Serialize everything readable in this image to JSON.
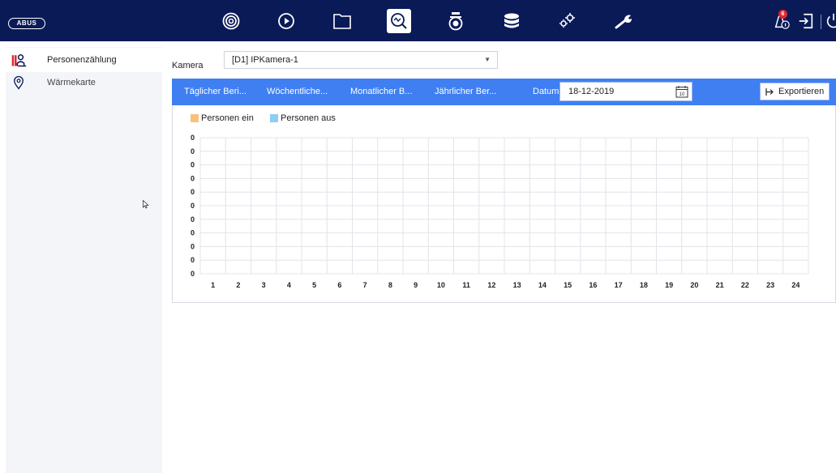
{
  "topbar": {
    "logo_text": "ABUS",
    "nav_icons": [
      {
        "name": "live-view-icon",
        "active": false
      },
      {
        "name": "playback-icon",
        "active": false
      },
      {
        "name": "file-manager-icon",
        "active": false
      },
      {
        "name": "search-analytics-icon",
        "active": true
      },
      {
        "name": "camera-icon",
        "active": false
      },
      {
        "name": "storage-icon",
        "active": false
      },
      {
        "name": "config-icon",
        "active": false
      },
      {
        "name": "maintenance-icon",
        "active": false
      }
    ],
    "alarm_badge": "6"
  },
  "sidebar": {
    "items": [
      {
        "label": "Personenzählung",
        "icon": "people-counting-icon",
        "active": true
      },
      {
        "label": "Wärmekarte",
        "icon": "heatmap-pin-icon",
        "active": false
      }
    ]
  },
  "camera": {
    "label": "Kamera",
    "value": "[D1] IPKamera-1"
  },
  "report_tabs": [
    "Täglicher Beri...",
    "Wöchentliche...",
    "Monatlicher B...",
    "Jährlicher Ber..."
  ],
  "datum": {
    "label": "Datum",
    "value": "18-12-2019",
    "calendar_day": "10"
  },
  "export_label": "Exportieren",
  "colors": {
    "topbar": "#0a1a57",
    "accent": "#3f7ff2",
    "persons_in": "#f7c17d",
    "persons_out": "#8ecdf4",
    "sidebar_active_icon": "#e3262f"
  },
  "chart_data": {
    "type": "bar",
    "title": "",
    "xlabel": "",
    "ylabel": "",
    "categories": [
      "1",
      "2",
      "3",
      "4",
      "5",
      "6",
      "7",
      "8",
      "9",
      "10",
      "11",
      "12",
      "13",
      "14",
      "15",
      "16",
      "17",
      "18",
      "19",
      "20",
      "21",
      "22",
      "23",
      "24"
    ],
    "y_tick_labels": [
      "0",
      "0",
      "0",
      "0",
      "0",
      "0",
      "0",
      "0",
      "0",
      "0",
      "0"
    ],
    "series": [
      {
        "name": "Personen ein",
        "color": "#f7c17d",
        "values": [
          0,
          0,
          0,
          0,
          0,
          0,
          0,
          0,
          0,
          0,
          0,
          0,
          0,
          0,
          0,
          0,
          0,
          0,
          0,
          0,
          0,
          0,
          0,
          0
        ]
      },
      {
        "name": "Personen aus",
        "color": "#8ecdf4",
        "values": [
          0,
          0,
          0,
          0,
          0,
          0,
          0,
          0,
          0,
          0,
          0,
          0,
          0,
          0,
          0,
          0,
          0,
          0,
          0,
          0,
          0,
          0,
          0,
          0
        ]
      }
    ],
    "grid": true,
    "legend": "top-left"
  }
}
